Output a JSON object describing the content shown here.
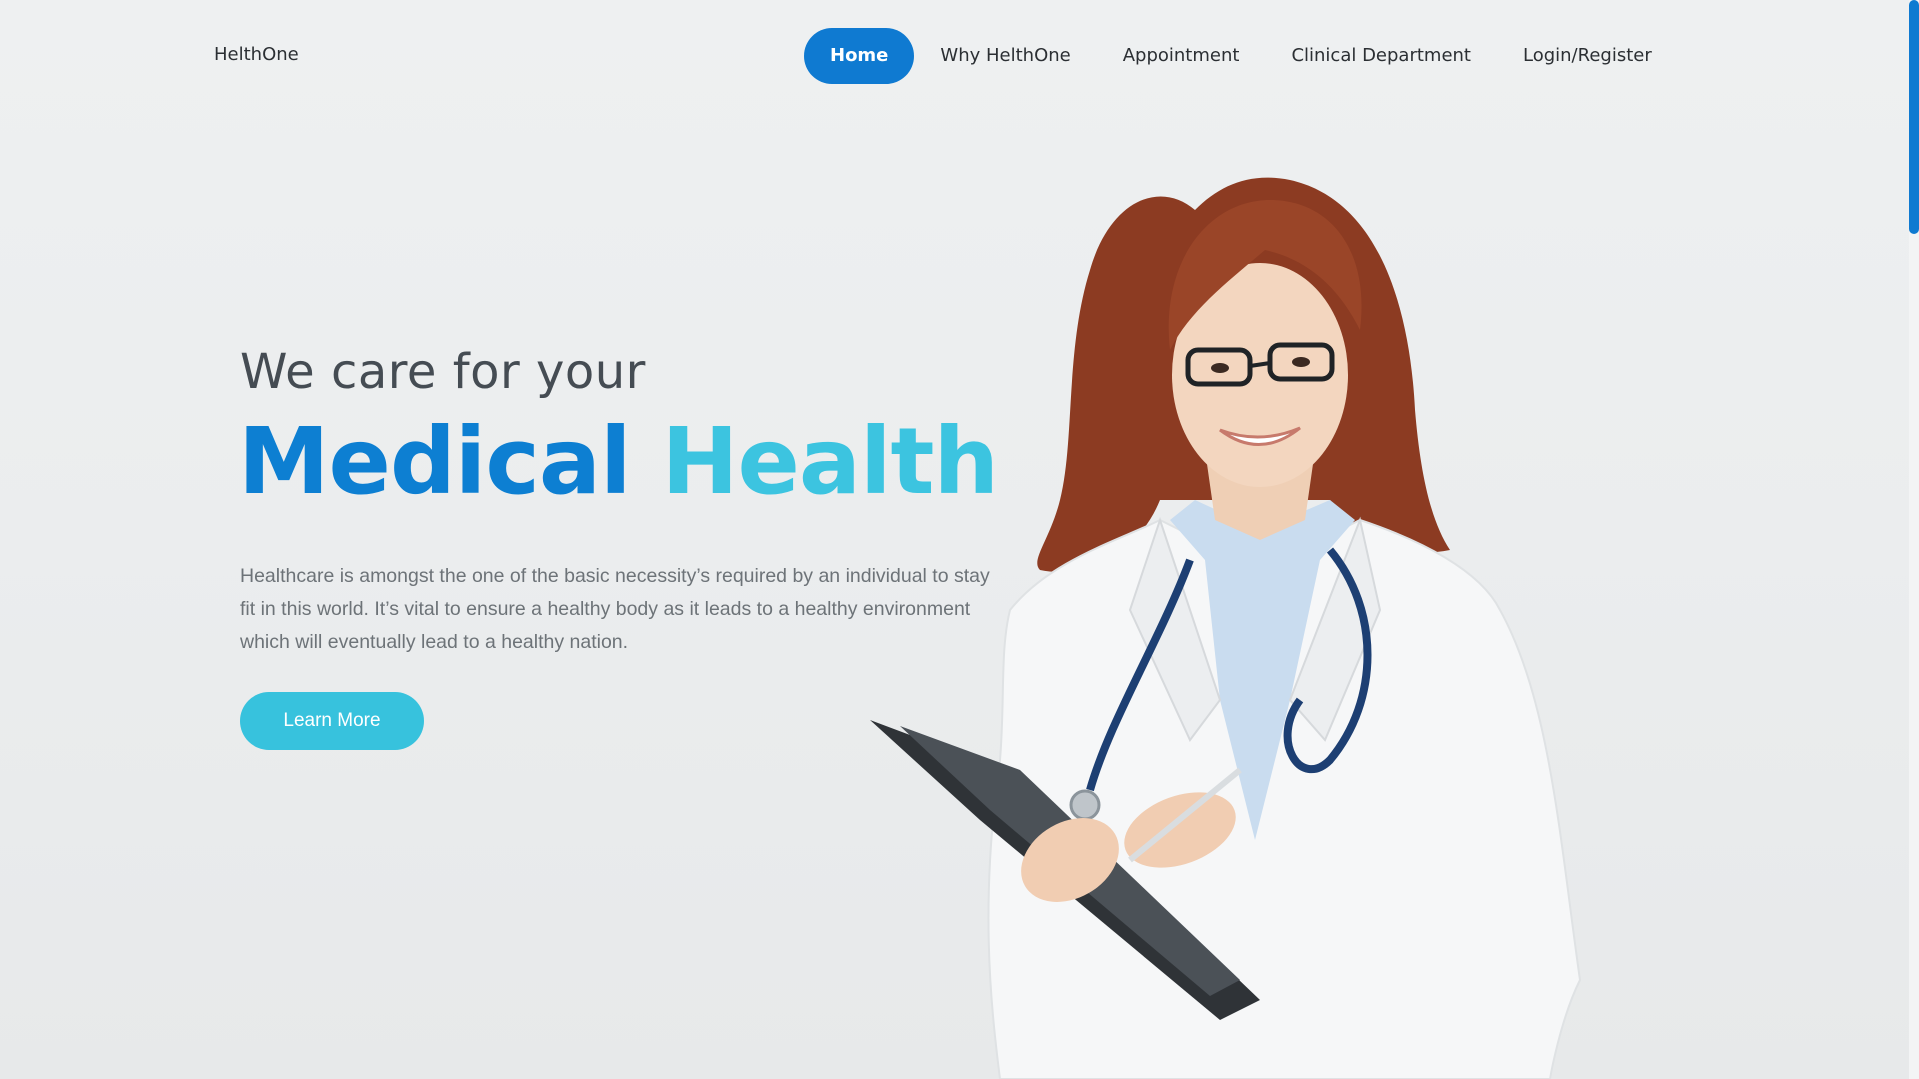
{
  "brand": {
    "name": "HelthOne"
  },
  "nav": {
    "items": [
      {
        "label": "Home",
        "active": true
      },
      {
        "label": "Why HelthOne"
      },
      {
        "label": "Appointment"
      },
      {
        "label": "Clinical Department"
      },
      {
        "label": "Login/Register"
      }
    ]
  },
  "hero": {
    "pre_title": "We care for your",
    "title_word_1": "Medical",
    "title_word_2": "Health",
    "description": "Healthcare is amongst the one of the basic necessity’s required by an individual to stay fit in this world. It’s vital to ensure a healthy body as it leads to a healthy environment which will eventually lead to a healthy nation.",
    "cta_label": "Learn More"
  },
  "colors": {
    "primary": "#0f7ad1",
    "accent": "#37c2dd",
    "title_primary": "#0d7fd2",
    "title_accent": "#3cc4e0",
    "text_dark": "#2b2f33",
    "text_muted": "#6d7378"
  },
  "image": {
    "subject": "smiling-doctor-with-clipboard"
  }
}
